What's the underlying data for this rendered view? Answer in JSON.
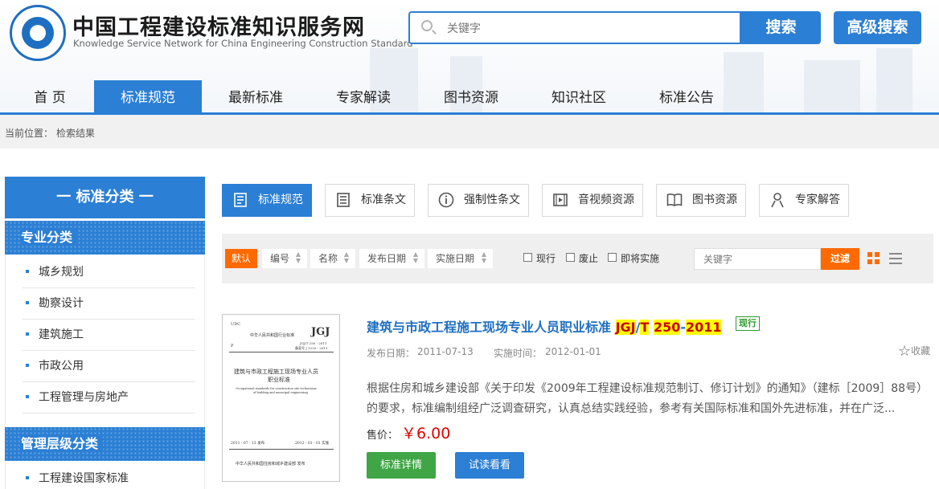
{
  "header": {
    "title": "中国工程建设标准知识服务网",
    "subtitle": "Knowledge Service Network for China Engineering Construction Standard",
    "search_placeholder": "关键字",
    "search_button": "搜索",
    "advanced_search_button": "高级搜索"
  },
  "nav": {
    "items": [
      "首 页",
      "标准规范",
      "最新标准",
      "专家解读",
      "图书资源",
      "知识社区",
      "标准公告"
    ],
    "active": "标准规范"
  },
  "breadcrumb": {
    "label": "当前位置：",
    "current": "检索结果"
  },
  "sidebar": {
    "heading": "一 标准分类 一",
    "sections": [
      {
        "title": "专业分类",
        "items": [
          "城乡规划",
          "勘察设计",
          "建筑施工",
          "市政公用",
          "工程管理与房地产"
        ]
      },
      {
        "title": "管理层级分类",
        "items": [
          "工程建设国家标准"
        ]
      }
    ]
  },
  "tabs": [
    {
      "label": "标准规范",
      "icon": "standard-doc-icon",
      "active": true
    },
    {
      "label": "标准条文",
      "icon": "clause-list-icon"
    },
    {
      "label": "强制性条文",
      "icon": "info-circle-icon"
    },
    {
      "label": "音视频资源",
      "icon": "film-icon"
    },
    {
      "label": "图书资源",
      "icon": "open-book-icon"
    },
    {
      "label": "专家解答",
      "icon": "person-icon"
    }
  ],
  "filter": {
    "sort_default": "默认",
    "sort_options": [
      "编号",
      "名称",
      "发布日期",
      "实施日期"
    ],
    "checkboxes": [
      "现行",
      "废止",
      "即将实施"
    ],
    "keyword_placeholder": "关键字",
    "filter_button": "过滤"
  },
  "result": {
    "title_prefix": "建筑与市政工程施工现场专业人员职业标准",
    "code_part1": "JGJ",
    "code_sep1": "/",
    "code_part2": "T",
    "code_part3": "250",
    "code_sep2": "-",
    "code_part4": "2011",
    "status": "现行",
    "publish_label": "发布日期：",
    "publish_date": "2011-07-13",
    "effective_label": "实施时间：",
    "effective_date": "2012-01-01",
    "favorite": "收藏",
    "desc_line1": "根据住房和城乡建设部《关于印发《2009年工程建设标准规范制订、修订计划》的通知》（建标［2009］88号）",
    "desc_line2": "的要求，标准编制组经广泛调查研究，认真总结实践经验，参考有关国际标准和国外先进标准，并在广泛...",
    "price_label": "售价：",
    "price": "￥6.00",
    "detail_button": "标准详情",
    "preview_button": "试读看看",
    "cover": {
      "top_left": "UDC",
      "publisher_line": "中华人民共和国行业标准",
      "code_logo": "JGJ",
      "code1": "JGJ/T 250 - 2011",
      "code2": "备案号 J 1220 - 2011",
      "letter": "P",
      "title_line1": "建筑与市政工程施工现场专业人员",
      "title_line2": "职业标准",
      "en_line1": "Occupational standards for construction site technicians",
      "en_line2": "of building and municipal engineering",
      "release": "2011 - 07 - 13  发布",
      "effective": "2012 - 01 - 01  实施",
      "issuer": "中华人民共和国住房和城乡建设部  发布"
    }
  },
  "colors": {
    "primary": "#2b7fd4",
    "accent": "#ff6a00",
    "price": "#e00000",
    "status": "#2e9a2e"
  }
}
